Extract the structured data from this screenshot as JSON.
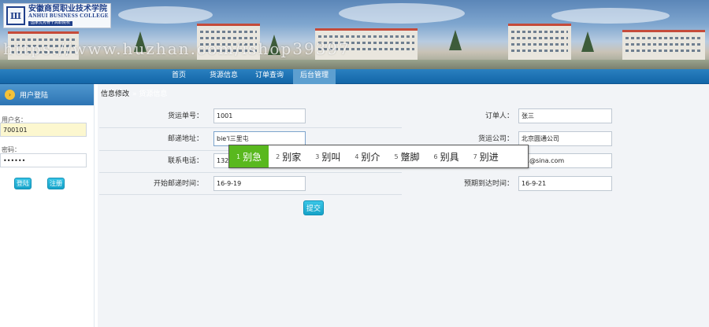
{
  "header": {
    "logo_cn": "安徽商贸职业技术学院",
    "logo_en": "ANHUI BUSINESS COLLEGE",
    "logo_sub": "国家优秀骨干高职院校",
    "watermark": "https://www.huzhan.com/ishop39397"
  },
  "nav": {
    "items": [
      {
        "label": "首页"
      },
      {
        "label": "货源信息"
      },
      {
        "label": "订单查询"
      },
      {
        "label": "后台管理"
      }
    ]
  },
  "sidebar": {
    "title": "用户登陆",
    "username_label": "用户名：",
    "username_value": "700101",
    "password_label": "密码：",
    "password_value": "••••••",
    "login_label": "登陆",
    "register_label": "注册"
  },
  "main": {
    "breadcrumb": "信息修改",
    "breadcrumb_tail": "» 货源信息",
    "form": {
      "order_no_label": "货运单号：",
      "order_no_value": "1001",
      "orderer_label": "订单人：",
      "orderer_value": "张三",
      "address_label": "邮递地址：",
      "address_value": "bie'l三里屯",
      "company_label": "货运公司：",
      "company_value": "北京圆通公司",
      "phone_label": "联系电话：",
      "phone_value": "132",
      "email_value": "01@sina.com",
      "start_label": "开始邮递时间：",
      "start_value": "16-9-19",
      "arrive_label": "预期到达时间：",
      "arrive_value": "16-9-21",
      "submit_label": "提交"
    }
  },
  "ime": {
    "candidates": [
      {
        "num": "1",
        "text": "别急"
      },
      {
        "num": "2",
        "text": "别家"
      },
      {
        "num": "3",
        "text": "别叫"
      },
      {
        "num": "4",
        "text": "别介"
      },
      {
        "num": "5",
        "text": "蹩脚"
      },
      {
        "num": "6",
        "text": "别具"
      },
      {
        "num": "7",
        "text": "别进"
      }
    ],
    "active_color": "#59b81e"
  }
}
